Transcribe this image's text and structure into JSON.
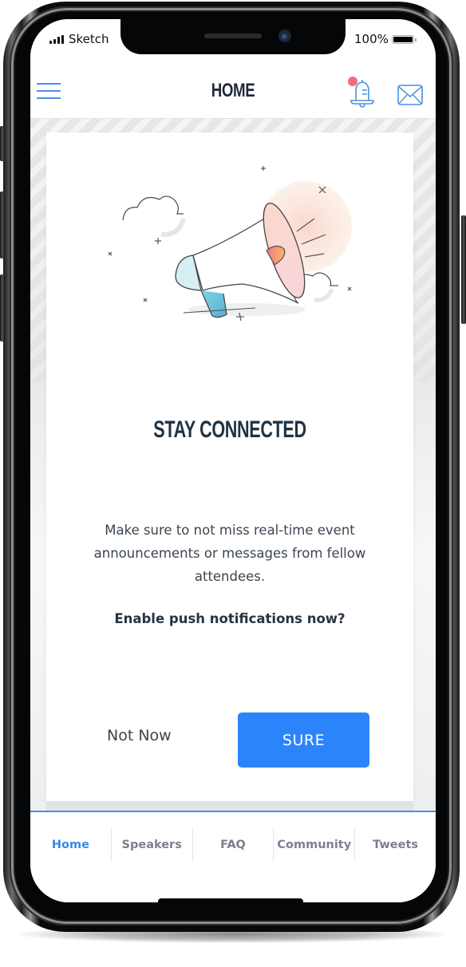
{
  "status_bar": {
    "carrier": "Sketch",
    "battery_percent": "100%",
    "signal_icon": "signal-bars-icon",
    "battery_icon": "battery-full-icon"
  },
  "header": {
    "title": "HOME",
    "menu_icon": "hamburger-menu-icon",
    "notifications_icon": "bell-icon",
    "notification_badge_color": "#ef6d7e",
    "messages_icon": "envelope-icon"
  },
  "card": {
    "illustration": "megaphone-illustration",
    "title": "STAY CONNECTED",
    "body": "Make sure to not miss real-time event announcements or messages from fellow attendees.",
    "question": "Enable push notifications now?",
    "secondary_button": "Not Now",
    "primary_button": "SURE"
  },
  "tabbar": {
    "active": "Home",
    "tabs": [
      {
        "label": "Home"
      },
      {
        "label": "Speakers"
      },
      {
        "label": "FAQ"
      },
      {
        "label": "Community"
      },
      {
        "label": "Tweets"
      }
    ]
  },
  "colors": {
    "accent": "#2c84fb",
    "tab_active": "#3b86e6",
    "tab_inactive": "#7b7f90",
    "title_dark": "#1f3344",
    "badge": "#ef6d7e"
  }
}
